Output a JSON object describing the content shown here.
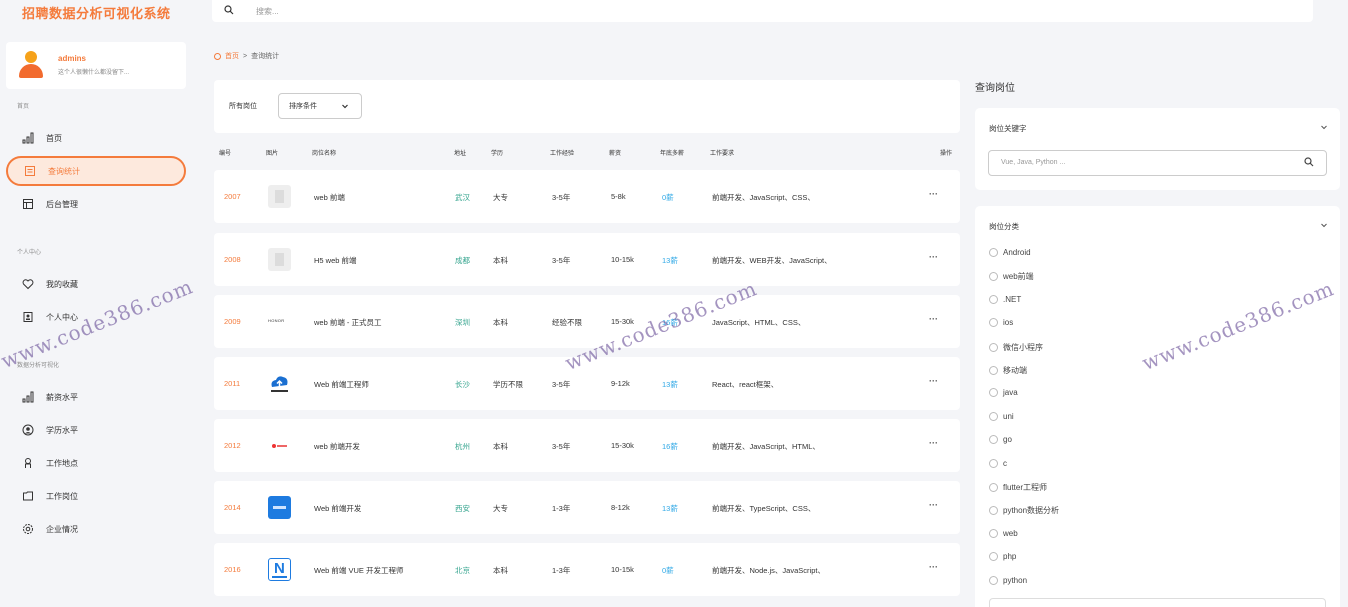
{
  "app": {
    "title": "招聘数据分析可视化系统"
  },
  "user": {
    "name": "admins",
    "signature": "这个人很懒什么都没留下..."
  },
  "sidebar": {
    "sections": [
      "首页",
      "个人中心",
      "数据分析可视化"
    ],
    "items": [
      {
        "label": "首页",
        "icon": "bar-chart-icon"
      },
      {
        "label": "查询统计",
        "icon": "document-icon"
      },
      {
        "label": "后台管理",
        "icon": "table-icon"
      },
      {
        "label": "我的收藏",
        "icon": "heart-icon"
      },
      {
        "label": "个人中心",
        "icon": "id-card-icon"
      },
      {
        "label": "薪资水平",
        "icon": "bar-chart-icon"
      },
      {
        "label": "学历水平",
        "icon": "user-circle-icon"
      },
      {
        "label": "工作地点",
        "icon": "location-icon"
      },
      {
        "label": "工作岗位",
        "icon": "folder-icon"
      },
      {
        "label": "企业情况",
        "icon": "gear-icon"
      }
    ]
  },
  "search": {
    "placeholder": "搜索..."
  },
  "breadcrumb": {
    "home": "首页",
    "separator": ">",
    "current": "查询统计"
  },
  "filter": {
    "all_label": "所有岗位",
    "sort_label": "排序条件"
  },
  "table": {
    "headers": [
      "编号",
      "图片",
      "岗位名称",
      "地址",
      "学历",
      "工作经验",
      "薪资",
      "年底多薪",
      "工作要求",
      "操作"
    ],
    "rows": [
      {
        "id": "2007",
        "name": "web 前端",
        "addr": "武汉",
        "edu": "大专",
        "exp": "3-5年",
        "salary": "5-8k",
        "bonus": "0薪",
        "req": "前端开发、JavaScript、CSS、",
        "more": "···",
        "thumb": "placeholder"
      },
      {
        "id": "2008",
        "name": "H5 web 前端",
        "addr": "成都",
        "edu": "本科",
        "exp": "3-5年",
        "salary": "10-15k",
        "bonus": "13薪",
        "req": "前端开发、WEB开发、JavaScript、",
        "more": "···",
        "thumb": "placeholder"
      },
      {
        "id": "2009",
        "name": "web 前端 - 正式员工",
        "addr": "深圳",
        "edu": "本科",
        "exp": "经验不限",
        "salary": "15-30k",
        "bonus": "16薪",
        "req": "JavaScript、HTML、CSS、",
        "more": "···",
        "thumb": "honor",
        "thumb_text": "HONOR"
      },
      {
        "id": "2011",
        "name": "Web 前端工程师",
        "addr": "长沙",
        "edu": "学历不限",
        "exp": "3-5年",
        "salary": "9-12k",
        "bonus": "13薪",
        "req": "React、react框架、",
        "more": "···",
        "thumb": "cloud"
      },
      {
        "id": "2012",
        "name": "web 前端开发",
        "addr": "杭州",
        "edu": "本科",
        "exp": "3-5年",
        "salary": "15-30k",
        "bonus": "16薪",
        "req": "前端开发、JavaScript、HTML、",
        "more": "···",
        "thumb": "red-logo"
      },
      {
        "id": "2014",
        "name": "Web 前端开发",
        "addr": "西安",
        "edu": "大专",
        "exp": "1-3年",
        "salary": "8-12k",
        "bonus": "13薪",
        "req": "前端开发、TypeScript、CSS、",
        "more": "···",
        "thumb": "blue"
      },
      {
        "id": "2016",
        "name": "Web 前端 VUE 开发工程师",
        "addr": "北京",
        "edu": "本科",
        "exp": "1-3年",
        "salary": "10-15k",
        "bonus": "0薪",
        "req": "前端开发、Node.js、JavaScript、",
        "more": "···",
        "thumb": "n-logo",
        "thumb_text": "N"
      }
    ]
  },
  "right_panel": {
    "title": "查询岗位",
    "keyword_title": "岗位关键字",
    "keyword_placeholder": "Vue, Java, Python ...",
    "category_title": "岗位分类",
    "categories": [
      "Android",
      "web前端",
      ".NET",
      "ios",
      "微信小程序",
      "移动端",
      "java",
      "uni",
      "go",
      "c",
      "flutter工程师",
      "python数据分析",
      "web",
      "php",
      "python"
    ]
  },
  "watermark": "www.code386.com",
  "colors": {
    "accent": "#f47b3c",
    "address": "#36a58f",
    "bonus": "#2fa8e6"
  }
}
